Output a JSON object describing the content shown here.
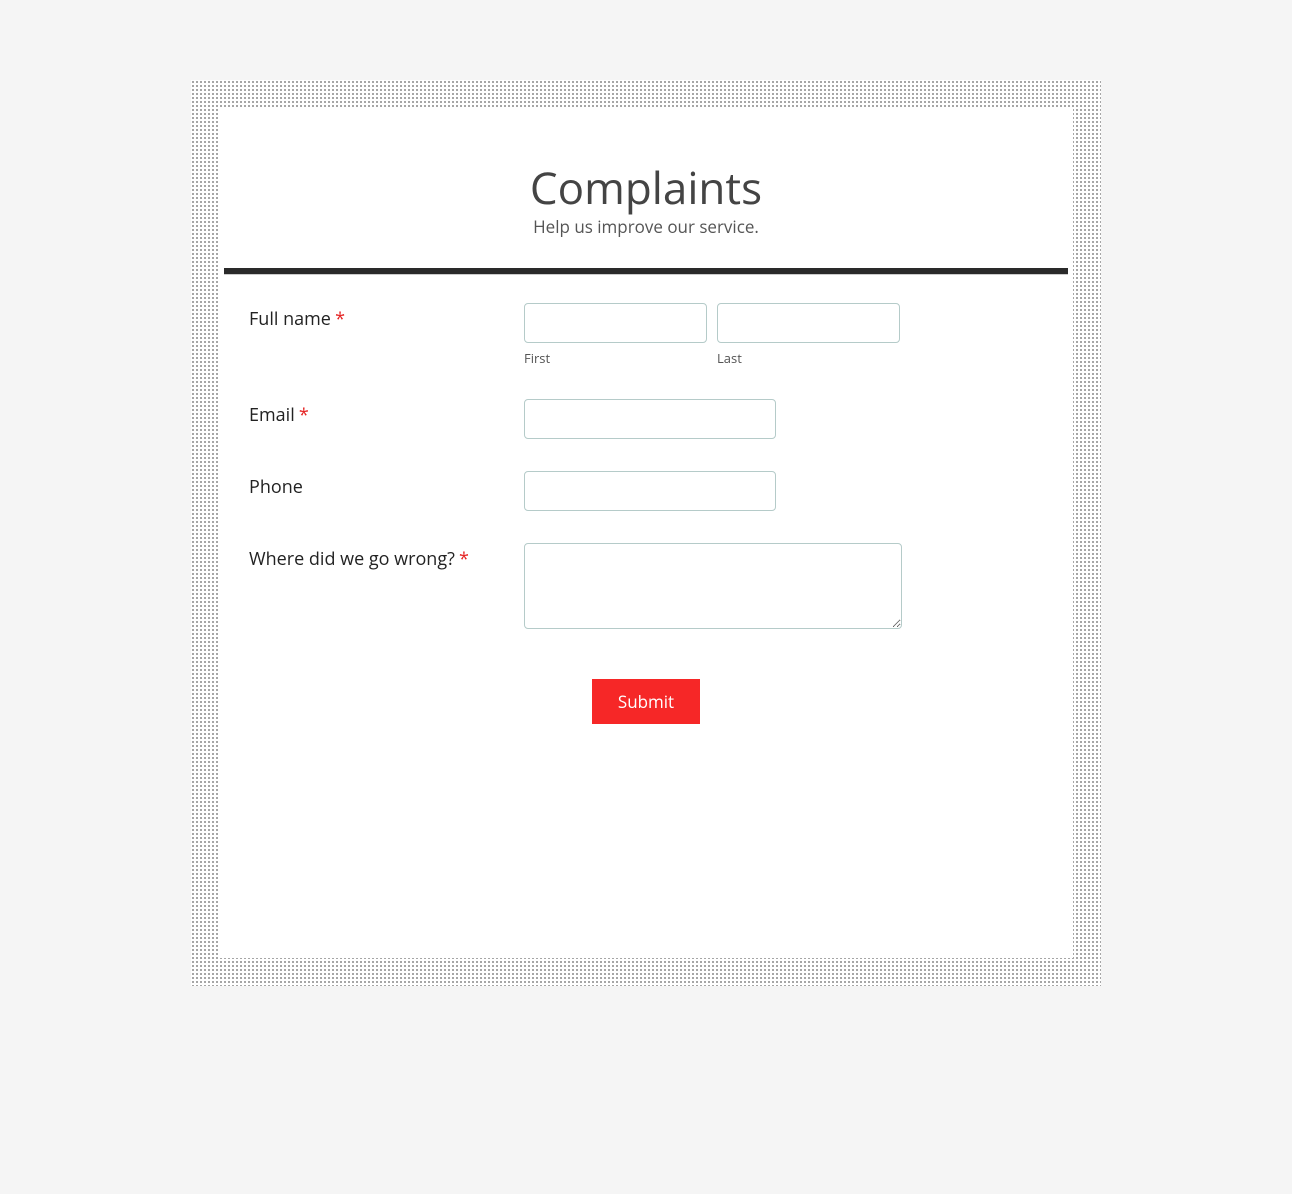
{
  "header": {
    "title": "Complaints",
    "subtitle": "Help us improve our service."
  },
  "fields": {
    "fullname": {
      "label": "Full name",
      "required": "*",
      "first_value": "",
      "first_sublabel": "First",
      "last_value": "",
      "last_sublabel": "Last"
    },
    "email": {
      "label": "Email",
      "required": "*",
      "value": ""
    },
    "phone": {
      "label": "Phone",
      "value": ""
    },
    "wrong": {
      "label": "Where did we go wrong?",
      "required": "*",
      "value": ""
    }
  },
  "submit_label": "Submit"
}
